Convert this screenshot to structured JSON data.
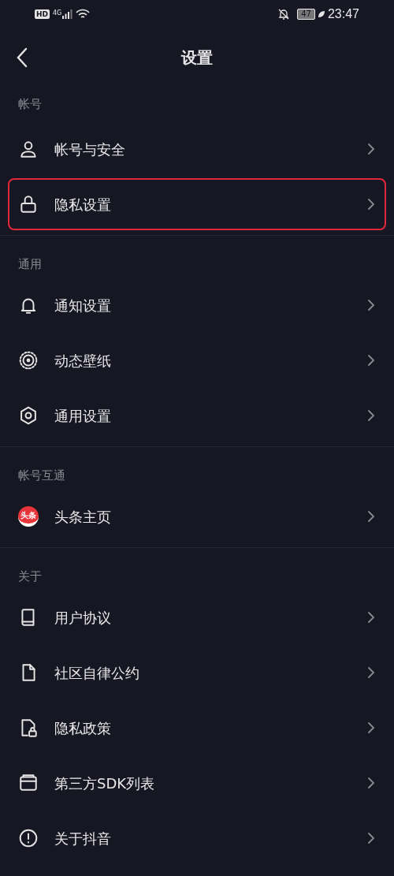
{
  "status_bar": {
    "hd": "HD",
    "network": "4G",
    "battery": "47",
    "time": "23:47"
  },
  "header": {
    "title": "设置"
  },
  "sections": [
    {
      "title": "帐号",
      "items": [
        {
          "label": "帐号与安全",
          "highlighted": false
        },
        {
          "label": "隐私设置",
          "highlighted": true
        }
      ]
    },
    {
      "title": "通用",
      "items": [
        {
          "label": "通知设置",
          "highlighted": false
        },
        {
          "label": "动态壁纸",
          "highlighted": false
        },
        {
          "label": "通用设置",
          "highlighted": false
        }
      ]
    },
    {
      "title": "帐号互通",
      "items": [
        {
          "label": "头条主页",
          "badge": "头条",
          "highlighted": false
        }
      ]
    },
    {
      "title": "关于",
      "items": [
        {
          "label": "用户协议",
          "highlighted": false
        },
        {
          "label": "社区自律公约",
          "highlighted": false
        },
        {
          "label": "隐私政策",
          "highlighted": false
        },
        {
          "label": "第三方SDK列表",
          "highlighted": false
        },
        {
          "label": "关于抖音",
          "highlighted": false
        }
      ]
    }
  ]
}
